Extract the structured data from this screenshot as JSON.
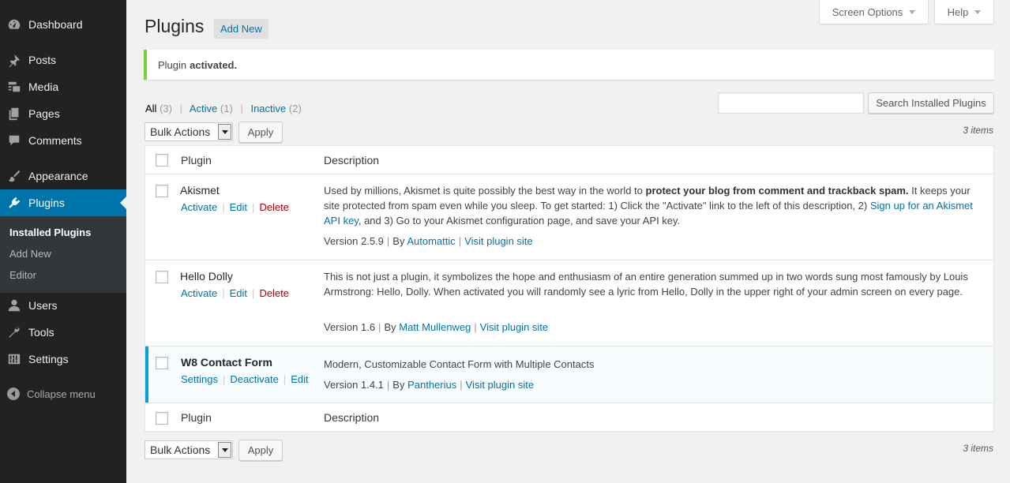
{
  "sidebar": {
    "items": [
      {
        "label": "Dashboard",
        "icon": "dashboard-icon"
      },
      {
        "label": "Posts",
        "icon": "pushpin-icon"
      },
      {
        "label": "Media",
        "icon": "media-icon"
      },
      {
        "label": "Pages",
        "icon": "pages-icon"
      },
      {
        "label": "Comments",
        "icon": "comment-icon"
      },
      {
        "label": "Appearance",
        "icon": "paintbrush-icon"
      },
      {
        "label": "Plugins",
        "icon": "plugin-icon"
      },
      {
        "label": "Users",
        "icon": "user-icon"
      },
      {
        "label": "Tools",
        "icon": "wrench-icon"
      },
      {
        "label": "Settings",
        "icon": "settings-sliders-icon"
      }
    ],
    "submenu": [
      "Installed Plugins",
      "Add New",
      "Editor"
    ],
    "collapse_label": "Collapse menu"
  },
  "topbar": {
    "screen_options": "Screen Options",
    "help": "Help"
  },
  "page": {
    "title": "Plugins",
    "add_new": "Add New"
  },
  "notice": {
    "prefix": "Plugin",
    "bold": "activated."
  },
  "filters": {
    "all": "All",
    "all_count": "(3)",
    "active": "Active",
    "active_count": "(1)",
    "inactive": "Inactive",
    "inactive_count": "(2)",
    "sep": "|"
  },
  "search": {
    "value": "",
    "button": "Search Installed Plugins"
  },
  "bulk": {
    "label": "Bulk Actions",
    "apply": "Apply",
    "items": "3 items"
  },
  "table": {
    "col_plugin": "Plugin",
    "col_description": "Description",
    "plugins": [
      {
        "name": "Akismet",
        "actions": [
          "Activate",
          "Edit",
          "Delete"
        ],
        "desc_1": "Used by millions, Akismet is quite possibly the best way in the world to ",
        "desc_bold": "protect your blog from comment and trackback spam.",
        "desc_2": " It keeps your site protected from spam even while you sleep. To get started: 1) Click the \"Activate\" link to the left of this description, 2) ",
        "desc_link": "Sign up for an Akismet API key",
        "desc_3": ", and 3) Go to your Akismet configuration page, and save your API key.",
        "version": "Version 2.5.9",
        "by": "By",
        "author": "Automattic",
        "site": "Visit plugin site"
      },
      {
        "name": "Hello Dolly",
        "actions": [
          "Activate",
          "Edit",
          "Delete"
        ],
        "desc": "This is not just a plugin, it symbolizes the hope and enthusiasm of an entire generation summed up in two words sung most famously by Louis Armstrong: Hello, Dolly. When activated you will randomly see a lyric from Hello, Dolly in the upper right of your admin screen on every page.",
        "version": "Version 1.6",
        "by": "By",
        "author": "Matt Mullenweg",
        "site": "Visit plugin site"
      },
      {
        "name": "W8 Contact Form",
        "actions": [
          "Settings",
          "Deactivate",
          "Edit"
        ],
        "desc": "Modern, Customizable Contact Form with Multiple Contacts",
        "version": "Version 1.4.1",
        "by": "By",
        "author": "Pantherius",
        "site": "Visit plugin site"
      }
    ]
  },
  "colors": {
    "sidebar_bg": "#222222",
    "active_menu": "#0073aa",
    "link": "#0073aa",
    "notice_border": "#7ad03a",
    "active_row_border": "#00a0d2",
    "delete": "#aa0000"
  }
}
